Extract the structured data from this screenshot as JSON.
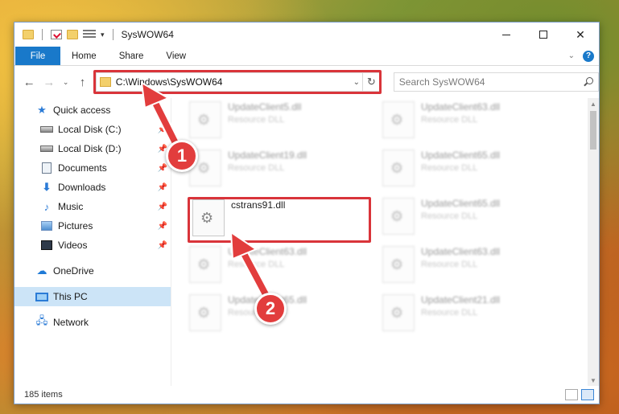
{
  "window": {
    "title": "SysWOW64",
    "controls": {
      "minimize": "",
      "maximize": "",
      "close": "✕"
    }
  },
  "quick_access_toolbar": {
    "dropdown": "▾"
  },
  "ribbon": {
    "tabs": [
      "File",
      "Home",
      "Share",
      "View"
    ],
    "collapse": "⌄",
    "help": "?"
  },
  "navbar": {
    "back": "←",
    "forward": "→",
    "recent": "⌄",
    "up": "↑",
    "address": "C:\\Windows\\SysWOW64",
    "address_dropdown": "⌄",
    "refresh": "↻",
    "search_placeholder": "Search SysWOW64"
  },
  "sidebar": {
    "items": [
      {
        "label": "Quick access",
        "icon": "star-icon",
        "glyph": "★",
        "pinned": false
      },
      {
        "label": "Local Disk (C:)",
        "icon": "disk-icon",
        "pinned": true
      },
      {
        "label": "Local Disk (D:)",
        "icon": "disk-icon",
        "pinned": true
      },
      {
        "label": "Documents",
        "icon": "documents-icon",
        "pinned": true
      },
      {
        "label": "Downloads",
        "icon": "downloads-icon",
        "glyph": "⬇",
        "pinned": true
      },
      {
        "label": "Music",
        "icon": "music-icon",
        "glyph": "♪",
        "pinned": true
      },
      {
        "label": "Pictures",
        "icon": "pictures-icon",
        "pinned": true
      },
      {
        "label": "Videos",
        "icon": "videos-icon",
        "pinned": true
      },
      {
        "label": "OneDrive",
        "icon": "onedrive-icon",
        "glyph": "☁"
      },
      {
        "label": "This PC",
        "icon": "this-pc-icon",
        "selected": true
      },
      {
        "label": "Network",
        "icon": "network-icon",
        "glyph": "🖧"
      }
    ],
    "pin_glyph": "📌"
  },
  "files": [
    {
      "name": "UpdateClient5.dll",
      "type": "Resource DLL",
      "blurred": true
    },
    {
      "name": "UpdateClient63.dll",
      "type": "Resource DLL",
      "blurred": true
    },
    {
      "name": "UpdateClient19.dll",
      "type": "Resource DLL",
      "blurred": true
    },
    {
      "name": "UpdateClient65.dll",
      "type": "Resource DLL",
      "blurred": true
    },
    {
      "name": "cstrans91.dll",
      "type": "",
      "blurred": false,
      "highlighted": true
    },
    {
      "name": "UpdateClient65.dll",
      "type": "Resource DLL",
      "blurred": true
    },
    {
      "name": "UpdateClient63.dll",
      "type": "Resource DLL",
      "blurred": true
    },
    {
      "name": "UpdateClient63.dll",
      "type": "Resource DLL",
      "blurred": true
    },
    {
      "name": "UpdateClient65.dll",
      "type": "Resource DLL",
      "blurred": true
    },
    {
      "name": "UpdateClient21.dll",
      "type": "Resource DLL",
      "blurred": true
    }
  ],
  "status": {
    "item_count": "185 items"
  },
  "annotations": {
    "callout_1": "1",
    "callout_2": "2",
    "accent": "#e23d3d"
  }
}
